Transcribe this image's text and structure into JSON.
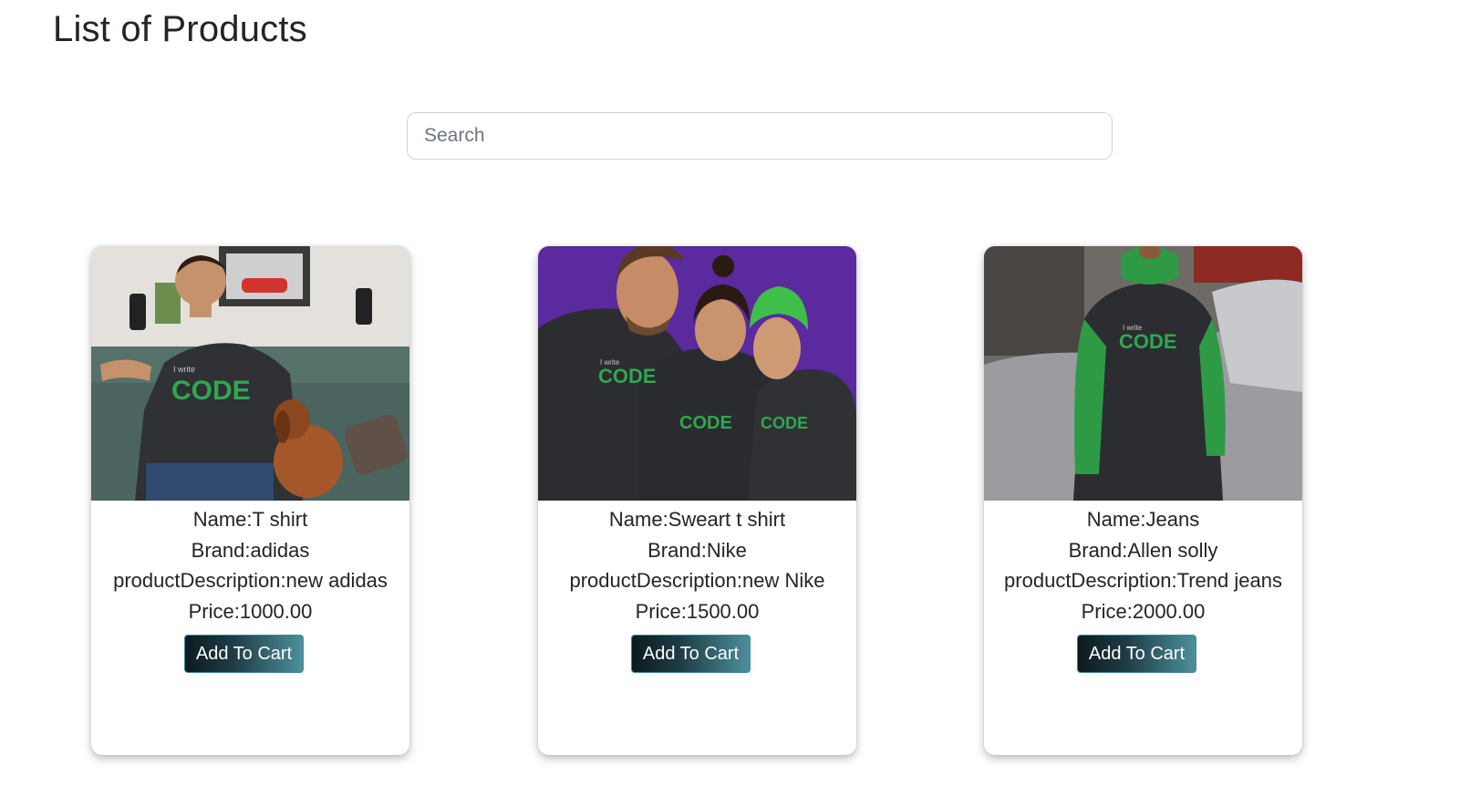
{
  "page": {
    "title": "List of Products"
  },
  "search": {
    "placeholder": "Search",
    "value": ""
  },
  "products": [
    {
      "name_line": "Name:T shirt",
      "brand_line": "Brand:adidas",
      "description_line": "productDescription:new adidas",
      "price_line": "Price:1000.00",
      "button_label": "Add To Cart",
      "image_text": "CODE"
    },
    {
      "name_line": "Name:Sweart t shirt",
      "brand_line": "Brand:Nike",
      "description_line": "productDescription:new Nike",
      "price_line": "Price:1500.00",
      "button_label": "Add To Cart",
      "image_text": "CODE"
    },
    {
      "name_line": "Name:Jeans",
      "brand_line": "Brand:Allen solly",
      "description_line": "productDescription:Trend jeans",
      "price_line": "Price:2000.00",
      "button_label": "Add To Cart",
      "image_text": "CODE"
    }
  ],
  "colors": {
    "button_gradient_start": "#0d1a1f",
    "button_gradient_end": "#4c8f9b",
    "print_green": "#2fa84f",
    "purple_backdrop": "#5b2a9e"
  }
}
